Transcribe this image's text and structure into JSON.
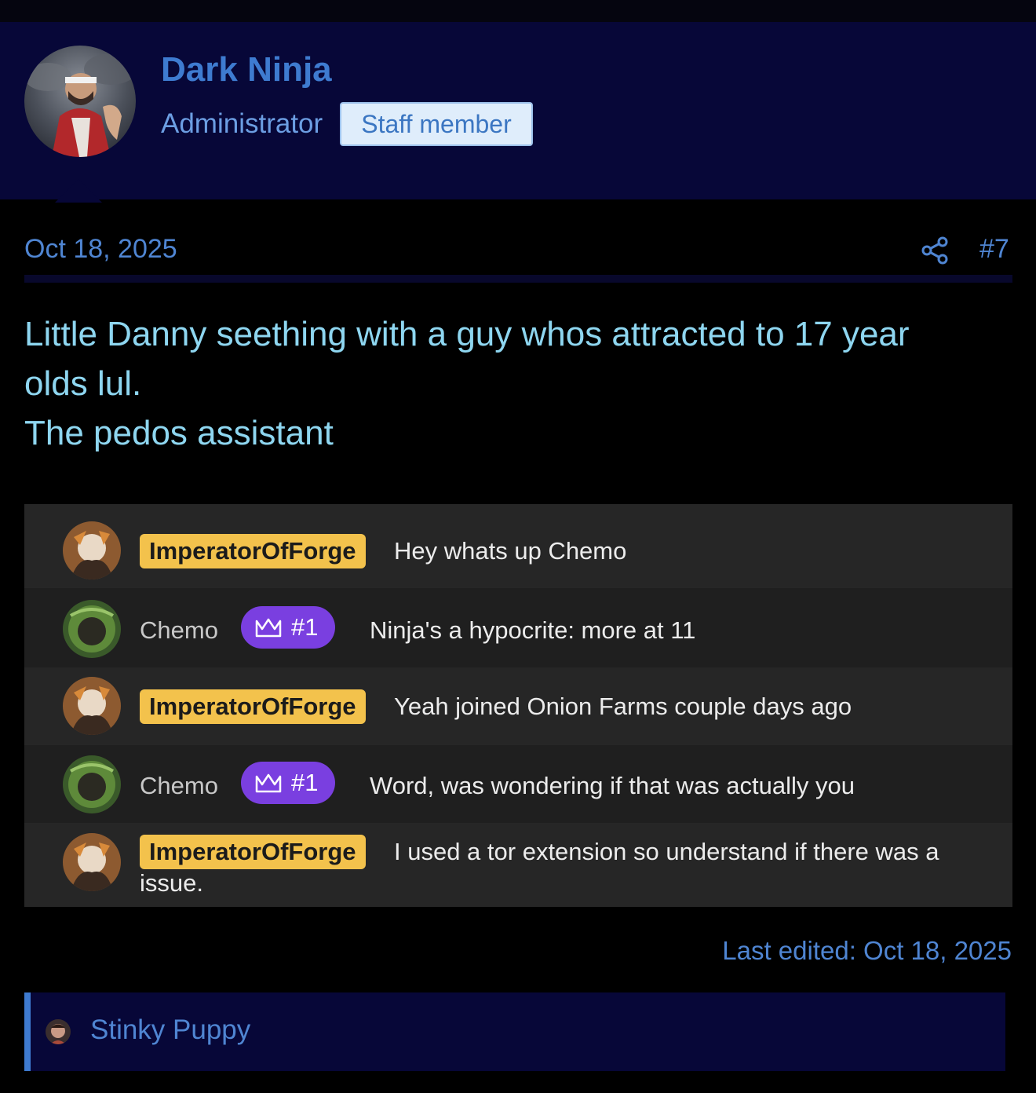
{
  "post": {
    "author": {
      "username": "Dark Ninja",
      "title": "Administrator",
      "badge": "Staff member"
    },
    "date": "Oct 18, 2025",
    "number": "#7",
    "body_lines": [
      "Little Danny seething with a guy whos attracted to 17 year olds lul.",
      "The pedos assistant"
    ],
    "last_edited": "Last edited: Oct 18, 2025",
    "reaction_user": "Stinky Puppy"
  },
  "chat": [
    {
      "user": "ImperatorOfForge",
      "style": "pill",
      "rank": null,
      "message": "Hey whats up Chemo"
    },
    {
      "user": "Chemo",
      "style": "plain",
      "rank": "#1",
      "message": "Ninja's a hypocrite: more at 11"
    },
    {
      "user": "ImperatorOfForge",
      "style": "pill",
      "rank": null,
      "message": "Yeah joined Onion Farms couple days ago"
    },
    {
      "user": "Chemo",
      "style": "plain",
      "rank": "#1",
      "message": "Word, was wondering if that was actually you"
    },
    {
      "user": "ImperatorOfForge",
      "style": "pill",
      "rank": null,
      "message": "I used a tor extension so understand if there was a",
      "message_wrap": "issue."
    }
  ],
  "icons": {
    "share": "share-icon",
    "crown": "crown-icon"
  },
  "colors": {
    "header_bg": "#070738",
    "link_blue": "#4f85d2",
    "body_text": "#8ed6f0",
    "name_pill": "#f3c24c",
    "rank_badge": "#7a3fe0"
  }
}
